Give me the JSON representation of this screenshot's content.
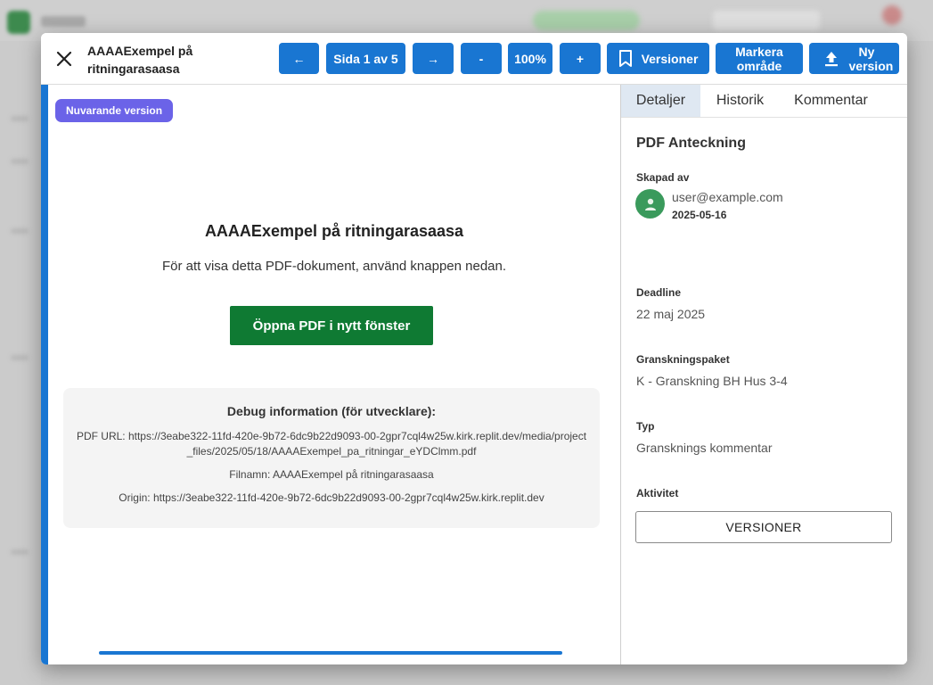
{
  "modal": {
    "title": "AAAAExempel på ritningarasaasa"
  },
  "toolbar": {
    "prev_label": "←",
    "page_label": "Sida 1 av 5",
    "next_label": "→",
    "zoom_out_label": "-",
    "zoom_level": "100%",
    "zoom_in_label": "+",
    "versions_label": "Versioner",
    "mark_area_label": "Markera område",
    "new_version_label": "Ny version"
  },
  "viewer": {
    "badge": "Nuvarande version",
    "title": "AAAAExempel på ritningarasaasa",
    "subtitle": "För att visa detta PDF-dokument, använd knappen nedan.",
    "open_button": "Öppna PDF i nytt fönster",
    "debug": {
      "title": "Debug information (för utvecklare):",
      "url": "PDF URL: https://3eabe322-11fd-420e-9b72-6dc9b22d9093-00-2gpr7cql4w25w.kirk.replit.dev/media/project_files/2025/05/18/AAAAExempel_pa_ritningar_eYDClmm.pdf",
      "filename": "Filnamn: AAAAExempel på ritningarasaasa",
      "origin": "Origin: https://3eabe322-11fd-420e-9b72-6dc9b22d9093-00-2gpr7cql4w25w.kirk.replit.dev"
    }
  },
  "side": {
    "tabs": [
      "Detaljer",
      "Historik",
      "Kommentar"
    ],
    "heading": "PDF Anteckning",
    "created_by_label": "Skapad av",
    "user_email": "user@example.com",
    "created_date": "2025-05-16",
    "deadline_label": "Deadline",
    "deadline_value": "22 maj 2025",
    "package_label": "Granskningspaket",
    "package_value": "K - Granskning BH Hus 3-4",
    "type_label": "Typ",
    "type_value": "Gransknings kommentar",
    "activity_label": "Aktivitet",
    "versions_button": "VERSIONER"
  },
  "colors": {
    "primary": "#1976d2",
    "badge": "#6b63e8",
    "open_button": "#0f7a33",
    "avatar": "#3a9a5c"
  },
  "icons": {
    "close": "close-icon",
    "bookmark": "bookmark-icon",
    "upload": "upload-icon",
    "person": "person-icon"
  }
}
